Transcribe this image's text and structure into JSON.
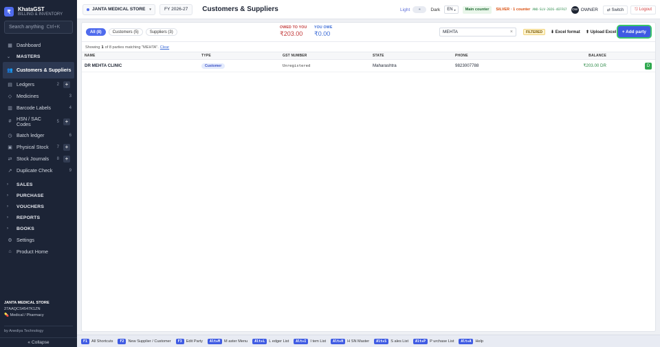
{
  "brand": {
    "logo": "₹",
    "name": "KhataGST",
    "subtitle": "BILLING & INVENTORY"
  },
  "search": {
    "placeholder": "Search anything",
    "shortcut": "Ctrl+K"
  },
  "sidebar": {
    "dashboard": {
      "label": "Dashboard",
      "icon": "grid-icon"
    },
    "masters_label": "MASTERS",
    "masters": [
      {
        "label": "Customers & Suppliers",
        "count": "1",
        "icon": "users-icon"
      },
      {
        "label": "Ledgers",
        "count": "2",
        "icon": "book-icon"
      },
      {
        "label": "Medicines",
        "count": "3",
        "icon": "tag-icon"
      },
      {
        "label": "Barcode Labels",
        "count": "4",
        "icon": "barcode-icon"
      },
      {
        "label": "HSN / SAC Codes",
        "count": "5",
        "icon": "hash-icon"
      },
      {
        "label": "Batch ledger",
        "count": "6",
        "icon": "clock-icon"
      },
      {
        "label": "Physical Stock",
        "count": "7",
        "icon": "box-icon"
      },
      {
        "label": "Stock Journals",
        "count": "8",
        "icon": "shuffle-icon"
      },
      {
        "label": "Duplicate Check",
        "count": "9",
        "icon": "wand-icon"
      }
    ],
    "groups": [
      "SALES",
      "PURCHASE",
      "VOUCHERS",
      "REPORTS",
      "BOOKS"
    ],
    "settings": "Settings",
    "product_home": "Product Home",
    "footer": {
      "store": "JANTA MEDICAL STORE",
      "gstin": "27AAQCS4547K1ZN",
      "type": "Medical / Pharmacy",
      "by": "by Anediya Technology"
    },
    "collapse": "« Collapse"
  },
  "topbar": {
    "store": "JANTA MEDICAL STORE",
    "fy": "FY 2026-27",
    "title": "Customers & Suppliers",
    "theme_light": "Light",
    "theme_dark": "Dark",
    "lang": "EN",
    "counter": "Main counter",
    "plan": "SILVER · 1 counter",
    "licence": "ANO-SLV-2026-4EFF67",
    "avatar": "OW",
    "role": "OWNER",
    "switch": "⇄ Switch",
    "logout": "⎋ Logout"
  },
  "toolbar": {
    "tabs": [
      {
        "label": "All (8)",
        "active": true
      },
      {
        "label": "Customers (5)",
        "active": false
      },
      {
        "label": "Suppliers (3)",
        "active": false
      }
    ],
    "owed_label": "OWED TO YOU",
    "owed_value": "₹203.00",
    "owe_label": "YOU OWE",
    "owe_value": "₹0.00",
    "filter_value": "MEHTA",
    "filtered_badge": "FILTERED",
    "excel_format": "⬇ Excel format",
    "upload_excel": "⬆ Upload Excel",
    "add_party": "+ Add party"
  },
  "showing": {
    "prefix": "Showing",
    "count": "1",
    "suffix": "of 8 parties matching \"MEHTA\".",
    "clear": "Clear"
  },
  "table": {
    "headers": [
      "NAME",
      "TYPE",
      "GST NUMBER",
      "STATE",
      "PHONE",
      "BALANCE"
    ],
    "rows": [
      {
        "name": "DR MEHTA CLINIC",
        "type": "Customer",
        "gst": "Unregistered",
        "state": "Maharashtra",
        "phone": "9823007788",
        "balance": "₹203.00 DR",
        "action": "D"
      }
    ]
  },
  "shortcuts": [
    {
      "key": "F1",
      "label": "All Shortcuts"
    },
    {
      "key": "F2",
      "label": "New Supplier / Customer"
    },
    {
      "key": "F3",
      "label": "Edit Party"
    },
    {
      "key": "Alt+M",
      "label": "M aster Menu"
    },
    {
      "key": "Alt+L",
      "label": "L edger List"
    },
    {
      "key": "Alt+I",
      "label": "I tem List"
    },
    {
      "key": "Alt+H",
      "label": "H SN Master"
    },
    {
      "key": "Alt+S",
      "label": "S ales List"
    },
    {
      "key": "Alt+P",
      "label": "P urchase List"
    },
    {
      "key": "Alt+A",
      "label": "Help"
    }
  ]
}
